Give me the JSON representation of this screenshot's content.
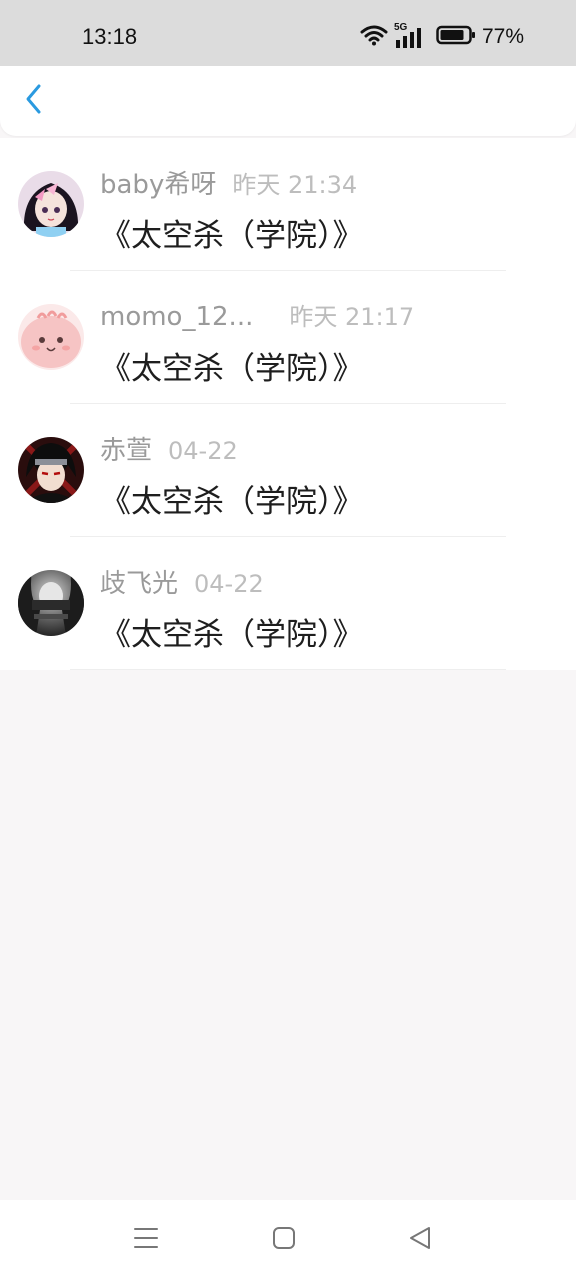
{
  "status_bar": {
    "time": "13:18",
    "network": "5G",
    "battery": "77%",
    "icons": [
      "wifi-icon",
      "signal-5g-icon",
      "battery-icon"
    ]
  },
  "header": {
    "back_icon": "chevron-left-icon",
    "accent_color": "#2a9ae0"
  },
  "messages": [
    {
      "username": "baby希呀",
      "time": "昨天 21:34",
      "text": "《太空杀（学院）》",
      "avatar": "anime-girl-avatar"
    },
    {
      "username": "momo_12...",
      "time": "昨天 21:17",
      "text": "《太空杀（学院）》",
      "avatar": "pink-blob-avatar"
    },
    {
      "username": "赤萱",
      "time": "04-22",
      "text": "《太空杀（学院）》",
      "avatar": "anime-boy-avatar"
    },
    {
      "username": "歧飞光",
      "time": "04-22",
      "text": "《太空杀（学院）》",
      "avatar": "dark-photo-avatar"
    }
  ],
  "nav_bar": {
    "icons": [
      "menu-icon",
      "home-icon",
      "back-triangle-icon"
    ]
  }
}
